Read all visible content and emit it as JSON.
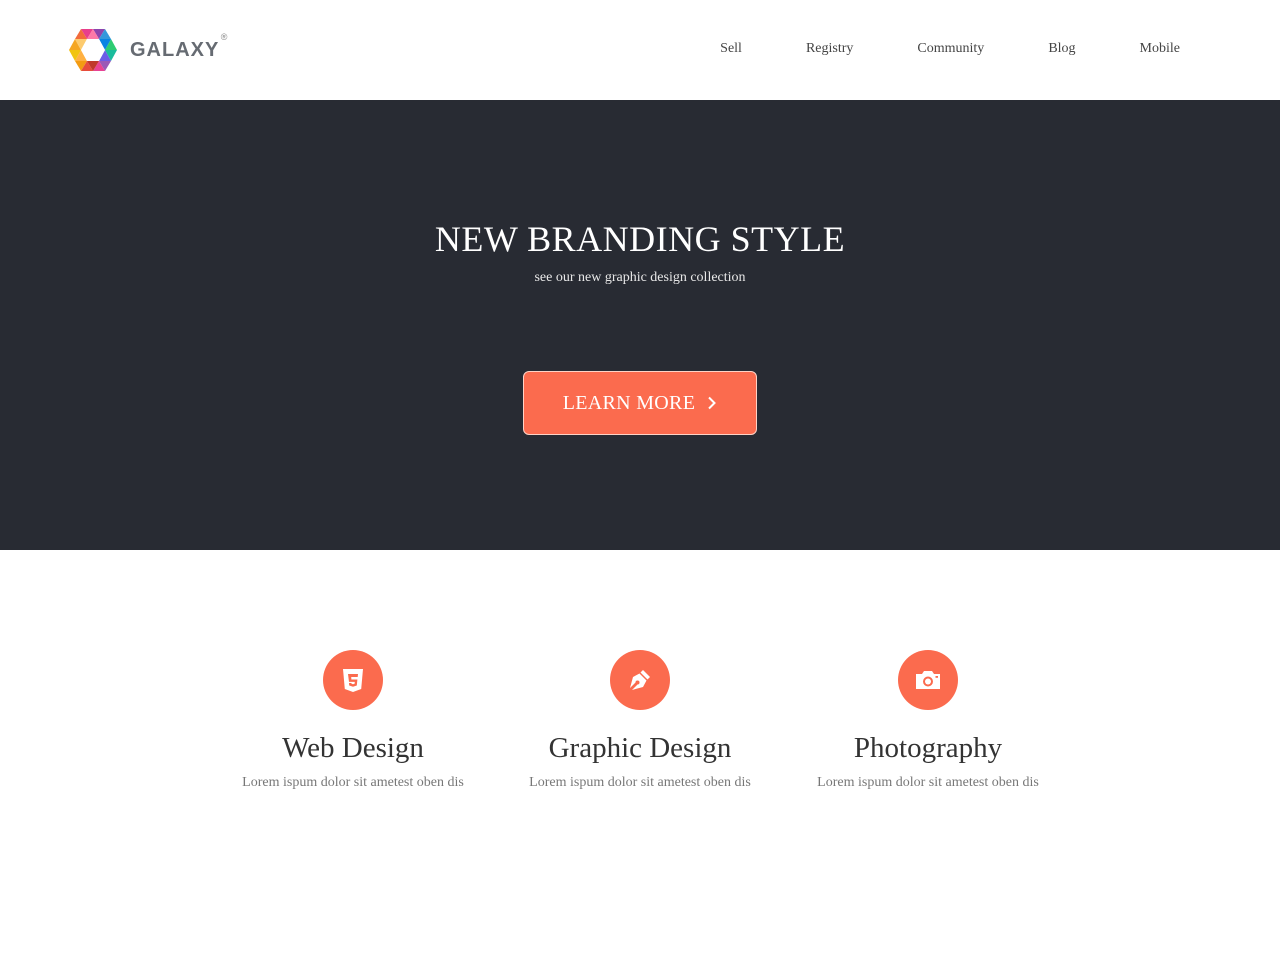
{
  "brand": {
    "name": "GALAXY",
    "registered_mark": "®"
  },
  "nav": {
    "items": [
      "Sell",
      "Registry",
      "Community",
      "Blog",
      "Mobile"
    ]
  },
  "hero": {
    "title": "NEW BRANDING STYLE",
    "subtitle": "see our new graphic design collection",
    "cta_label": "LEARN MORE",
    "cta_icon": "chevron-right-icon"
  },
  "features": [
    {
      "icon": "html5-icon",
      "title": "Web Design",
      "text": "Lorem ispum dolor sit ametest oben dis"
    },
    {
      "icon": "pen-nib-icon",
      "title": "Graphic Design",
      "text": "Lorem ispum dolor sit ametest oben dis"
    },
    {
      "icon": "camera-icon",
      "title": "Photography",
      "text": "Lorem ispum dolor sit ametest oben dis"
    }
  ],
  "colors": {
    "accent": "#fb6b4e",
    "hero_background": "#282b33",
    "page_background": "#ffffff"
  }
}
